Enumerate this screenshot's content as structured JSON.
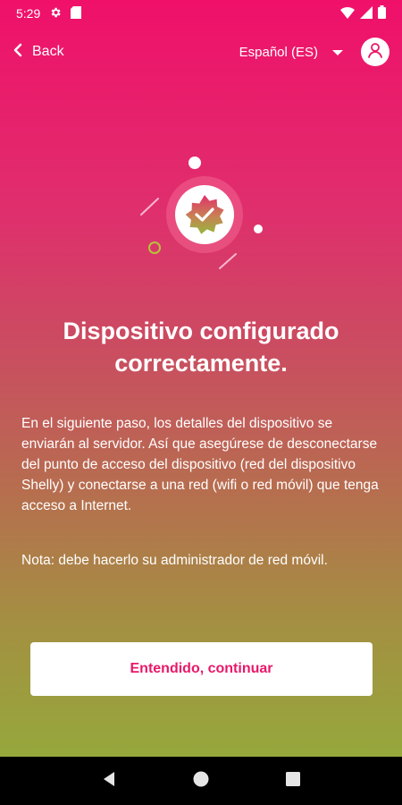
{
  "status_bar": {
    "time": "5:29",
    "icons": [
      "gear-icon",
      "sd-card-icon",
      "wifi-icon",
      "signal-icon",
      "battery-icon"
    ]
  },
  "app_bar": {
    "back_label": "Back",
    "language": "Español (ES)"
  },
  "content": {
    "title": "Dispositivo configurado correctamente.",
    "body": "En el siguiente paso, los detalles del dispositivo se enviarán al servidor. Así que asegúrese de desconectarse del punto de acceso del dispositivo (red del dispositivo Shelly) y conectarse a una red (wifi o red móvil) que tenga acceso a Internet.",
    "note": "Nota: debe hacerlo su administrador de red móvil."
  },
  "actions": {
    "continue_label": "Entendido, continuar"
  },
  "colors": {
    "gradient_top": "#f0106a",
    "gradient_bottom": "#96a83c",
    "button_text": "#e8186a"
  }
}
